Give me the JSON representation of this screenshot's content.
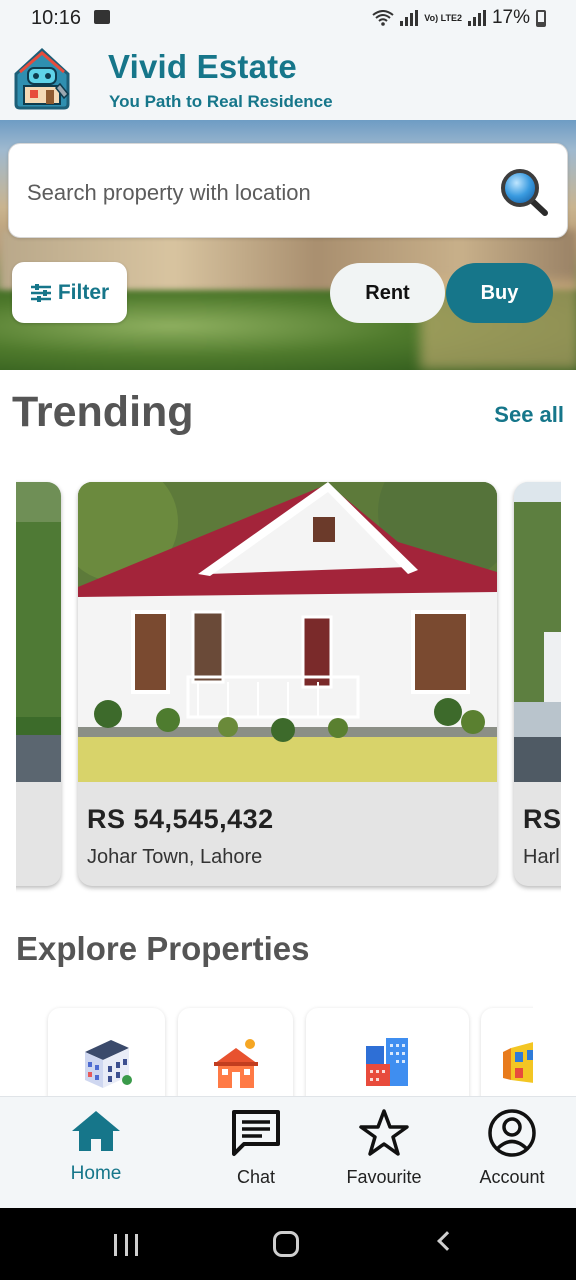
{
  "status_bar": {
    "time": "10:16",
    "volte_label": "Vo) LTE2",
    "battery_percent": "17%"
  },
  "header": {
    "title": "Vivid Estate",
    "subtitle": "You Path to Real Residence"
  },
  "search": {
    "placeholder": "Search property with location"
  },
  "filters": {
    "filter_label": "Filter",
    "rent_label": "Rent",
    "buy_label": "Buy",
    "selected": "Buy"
  },
  "trending": {
    "title": "Trending",
    "see_all": "See all",
    "cards": [
      {
        "price": "",
        "location": ""
      },
      {
        "price": "RS 54,545,432",
        "location": "Johar Town, Lahore"
      },
      {
        "price": "RS",
        "location": "Harl"
      }
    ]
  },
  "explore": {
    "title": "Explore Properties",
    "items": [
      {
        "icon": "apartment-building-icon"
      },
      {
        "icon": "house-icon"
      },
      {
        "icon": "office-buildings-icon"
      },
      {
        "icon": "shop-icon"
      }
    ]
  },
  "bottom_nav": {
    "items": [
      {
        "label": "Home",
        "icon": "home-icon",
        "active": true
      },
      {
        "label": "Chat",
        "icon": "chat-icon",
        "active": false
      },
      {
        "label": "Favourite",
        "icon": "star-icon",
        "active": false
      },
      {
        "label": "Account",
        "icon": "account-icon",
        "active": false
      }
    ]
  },
  "colors": {
    "primary": "#16768a",
    "heading": "#555555",
    "card_bg": "#e4e4e4"
  }
}
